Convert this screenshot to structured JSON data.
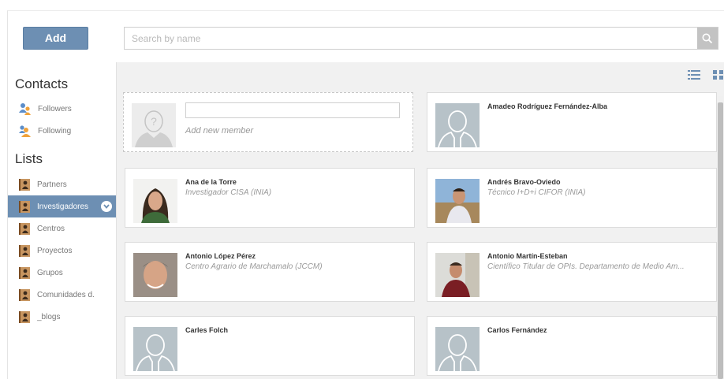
{
  "toolbar": {
    "add_label": "Add",
    "search_placeholder": "Search by name"
  },
  "sidebar": {
    "contacts_title": "Contacts",
    "contacts": [
      {
        "label": "Followers",
        "icon": "followers-icon"
      },
      {
        "label": "Following",
        "icon": "following-icon"
      }
    ],
    "lists_title": "Lists",
    "lists": [
      {
        "label": "Partners"
      },
      {
        "label": "Investigadores",
        "active": true
      },
      {
        "label": "Centros"
      },
      {
        "label": "Proyectos"
      },
      {
        "label": "Grupos"
      },
      {
        "label": "Comunidades d."
      },
      {
        "label": "_blogs"
      }
    ]
  },
  "main": {
    "new_member_hint": "Add new member",
    "members": [
      {
        "name": "Amadeo Rodríguez Fernández-Alba",
        "role": "",
        "avatar": "placeholder"
      },
      {
        "name": "Ana de la Torre",
        "role": "Investigador CISA (INIA)",
        "avatar": "photo"
      },
      {
        "name": "Andrés Bravo-Oviedo",
        "role": "Técnico I+D+i CIFOR (INIA)",
        "avatar": "photo"
      },
      {
        "name": "Antonio López Pérez",
        "role": "Centro Agrario de Marchamalo (JCCM)",
        "avatar": "photo"
      },
      {
        "name": "Antonio Martín-Esteban",
        "role": "Científico Titular de OPIs. Departamento de Medio Am...",
        "avatar": "photo"
      },
      {
        "name": "Carles Folch",
        "role": "",
        "avatar": "placeholder"
      },
      {
        "name": "Carlos Fernández",
        "role": "",
        "avatar": "placeholder"
      }
    ]
  },
  "colors": {
    "accent": "#6d8fb3",
    "main_bg": "#f1f1f1",
    "placeholder_avatar": "#b7c2c8"
  }
}
